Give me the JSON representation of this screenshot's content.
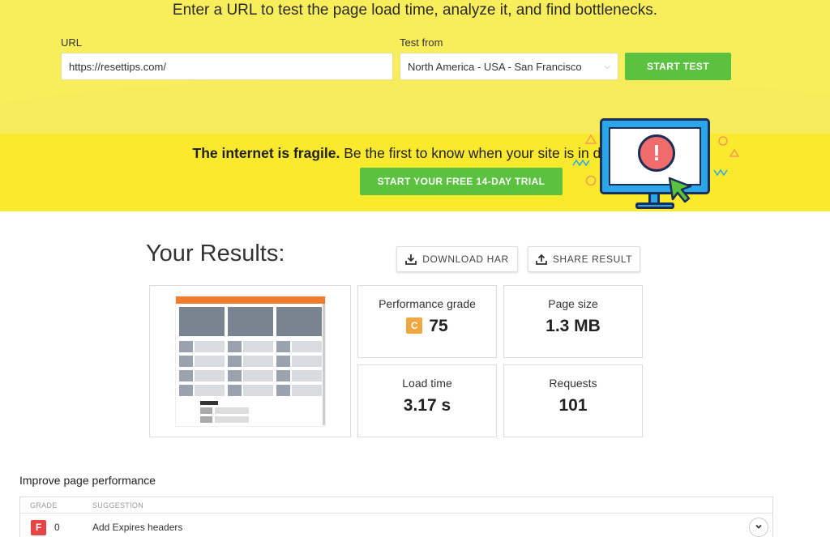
{
  "hero": {
    "headline": "Enter a URL to test the page load time, analyze it, and find bottlenecks.",
    "url_label": "URL",
    "url_value": "https://resettips.com/",
    "test_from_label": "Test from",
    "test_from_value": "North America - USA - San Francisco",
    "start_test_label": "START TEST"
  },
  "banner": {
    "bold_text": "The internet is fragile.",
    "text": " Be the first to know when your site is in danger.",
    "trial_label": "START YOUR FREE 14-DAY TRIAL",
    "alert_symbol": "!"
  },
  "results": {
    "title": "Your Results:",
    "download_label": "DOWNLOAD HAR",
    "share_label": "SHARE RESULT",
    "performance_grade_label": "Performance grade",
    "performance_grade_letter": "C",
    "performance_grade_score": "75",
    "page_size_label": "Page size",
    "page_size_value": "1.3 MB",
    "load_time_label": "Load time",
    "load_time_value": "3.17 s",
    "requests_label": "Requests",
    "requests_value": "101"
  },
  "improve": {
    "title": "Improve page performance",
    "columns": [
      "GRADE",
      "SUGGESTION"
    ],
    "rows": [
      {
        "grade": "F",
        "score": "0",
        "suggestion": "Add Expires headers"
      }
    ]
  },
  "colors": {
    "hero_bg": "#f8ee5c",
    "banner_bg": "#fbe92d",
    "accent_green": "#5ac23f",
    "grade_c": "#f0a742",
    "grade_f": "#e64545"
  }
}
